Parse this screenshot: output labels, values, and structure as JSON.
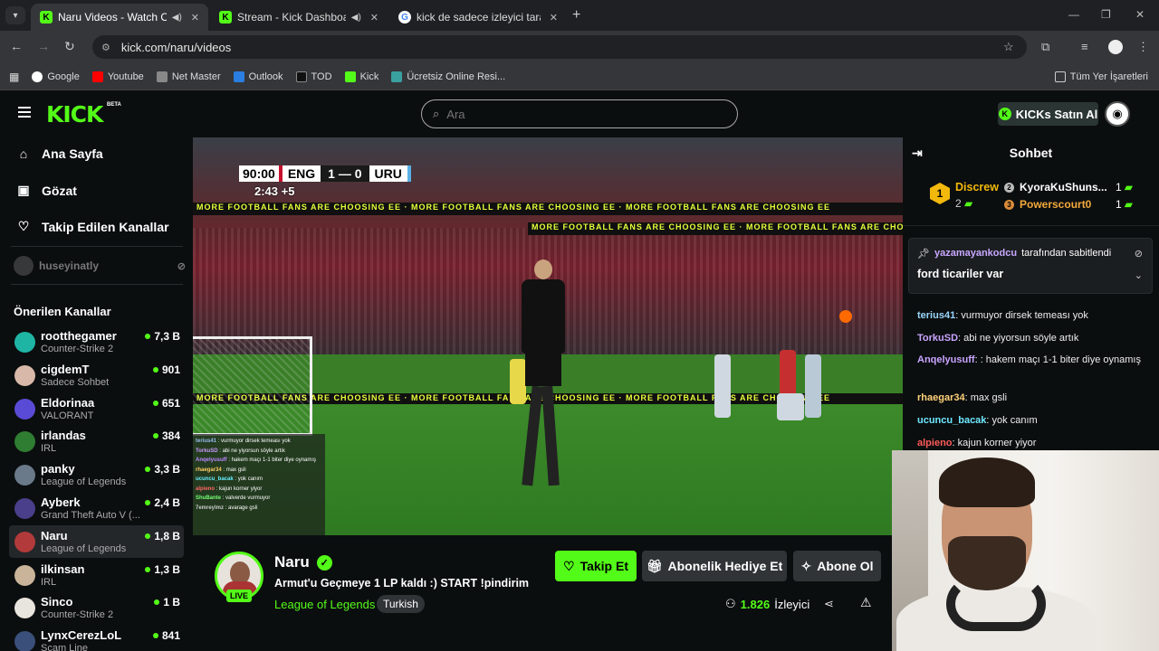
{
  "browser": {
    "tabs": [
      {
        "title": "Naru Videos - Watch On-De",
        "active": true,
        "favicon": "kick"
      },
      {
        "title": "Stream - Kick Dashboard",
        "active": false,
        "favicon": "kick"
      },
      {
        "title": "kick de sadece izleyici tarafında",
        "active": false,
        "favicon": "google"
      }
    ],
    "url": "kick.com/naru/videos",
    "bookmarks": [
      "Google",
      "Youtube",
      "Net Master",
      "Outlook",
      "TOD",
      "Kick",
      "Ücretsiz Online Resi...",
      "Tüm Yer İşaretleri"
    ]
  },
  "header": {
    "logo": "KICK",
    "beta": "BETA",
    "search_placeholder": "Ara",
    "kicks_button": "KICKs Satın Al"
  },
  "sidebar": {
    "nav": [
      {
        "label": "Ana Sayfa",
        "icon": "home-icon"
      },
      {
        "label": "Gözat",
        "icon": "browse-icon"
      },
      {
        "label": "Takip Edilen Kanallar",
        "icon": "heart-icon"
      }
    ],
    "followed": "huseyinatly",
    "recommended_title": "Önerilen Kanallar",
    "channels": [
      {
        "name": "rootthegamer",
        "category": "Counter-Strike 2",
        "viewers": "7,3 B",
        "color": "#1fb5a5"
      },
      {
        "name": "cigdemT",
        "category": "Sadece Sohbet",
        "viewers": "901",
        "color": "#d8b8a8"
      },
      {
        "name": "Eldorinaa",
        "category": "VALORANT",
        "viewers": "651",
        "color": "#5a4bd6"
      },
      {
        "name": "irlandas",
        "category": "IRL",
        "viewers": "384",
        "color": "#2e7d32"
      },
      {
        "name": "panky",
        "category": "League of Legends",
        "viewers": "3,3 B",
        "color": "#6a7a8a"
      },
      {
        "name": "Ayberk",
        "category": "Grand Theft Auto V (...",
        "viewers": "2,4 B",
        "color": "#4a3f8a"
      },
      {
        "name": "Naru",
        "category": "League of Legends",
        "viewers": "1,8 B",
        "color": "#b23a3a",
        "selected": true
      },
      {
        "name": "ilkinsan",
        "category": "IRL",
        "viewers": "1,3 B",
        "color": "#c9b49a"
      },
      {
        "name": "Sinco",
        "category": "Counter-Strike 2",
        "viewers": "1 B",
        "color": "#e8e4de"
      },
      {
        "name": "LynxCerezLoL",
        "category": "Scam Line",
        "viewers": "841",
        "color": "#3a4f7a"
      }
    ]
  },
  "video": {
    "clock": "90:00",
    "team1": "ENG",
    "score": "1 — 0",
    "team2": "URU",
    "added_time": "2:43  +5",
    "banner": "MORE FOOTBALL FANS ARE CHOOSING EE  ·  MORE FOOTBALL FANS ARE CHOOSING EE  ·  MORE FOOTBALL FANS ARE CHOOSING EE",
    "overlay_chat": [
      {
        "user": "terius41",
        "text": "vurmuyor dirsek temeası yok",
        "color": "#9be"
      },
      {
        "user": "TorkuSD",
        "text": "abi ne yiyorsun söyle artık",
        "color": "#c9f"
      },
      {
        "user": "Anqelyusuff",
        "text": "hakem maçı 1-1 biter diye oynamış",
        "color": "#b8f"
      },
      {
        "user": "rhaegar34",
        "text": "max gsli",
        "color": "#fc6"
      },
      {
        "user": "ucuncu_bacak",
        "text": "yok canım",
        "color": "#6ef"
      },
      {
        "user": "alpieno",
        "text": "kajun korner yiyor",
        "color": "#f66"
      },
      {
        "user": "ShuBante",
        "text": "valverde vurmuyor",
        "color": "#7f7"
      },
      {
        "user": "7emreylmz",
        "text": "avarage gsli",
        "color": "#ccc"
      }
    ]
  },
  "stream": {
    "name": "Naru",
    "live": "LIVE",
    "title": "Armut'u Geçmeye 1 LP kaldı :) START !pindirim",
    "category": "League of Legends",
    "tag": "Turkish",
    "follow": "Takip Et",
    "gift": "Abonelik Hediye Et",
    "subscribe": "Abone Ol",
    "viewers": "1.826",
    "viewers_label": "İzleyici"
  },
  "chat": {
    "title": "Sohbet",
    "top_gifter": {
      "rank": "1",
      "name": "Discrew",
      "count": "2"
    },
    "gifters": [
      {
        "rank": "2",
        "name": "KyoraKuShuns...",
        "count": "1"
      },
      {
        "rank": "3",
        "name": "Powerscourt0",
        "count": "1"
      }
    ],
    "pinned_by": "yazamayankodcu",
    "pinned_suffix": "tarafından sabitlendi",
    "pinned_message": "ford ticariler var",
    "messages": [
      {
        "user": "terius41",
        "text": "vurmuyor dirsek temeası yok",
        "color": "#9bd8ff"
      },
      {
        "user": "TorkuSD",
        "text": "abi ne yiyorsun söyle artık",
        "color": "#c9a5ff"
      },
      {
        "user": "Anqelyusuff",
        "text": ": hakem maçı 1-1 biter diye oynamış",
        "color": "#c9a5ff"
      },
      {
        "user": "rhaegar34",
        "text": "max gsli",
        "color": "#ffd27a"
      },
      {
        "user": "ucuncu_bacak",
        "text": "yok canım",
        "color": "#6ee8ff"
      },
      {
        "user": "alpieno",
        "text": "kajun korner yiyor",
        "color": "#ff5a5a"
      }
    ]
  },
  "colors": {
    "brand": "#53fc18",
    "background": "#0b0e0f"
  }
}
